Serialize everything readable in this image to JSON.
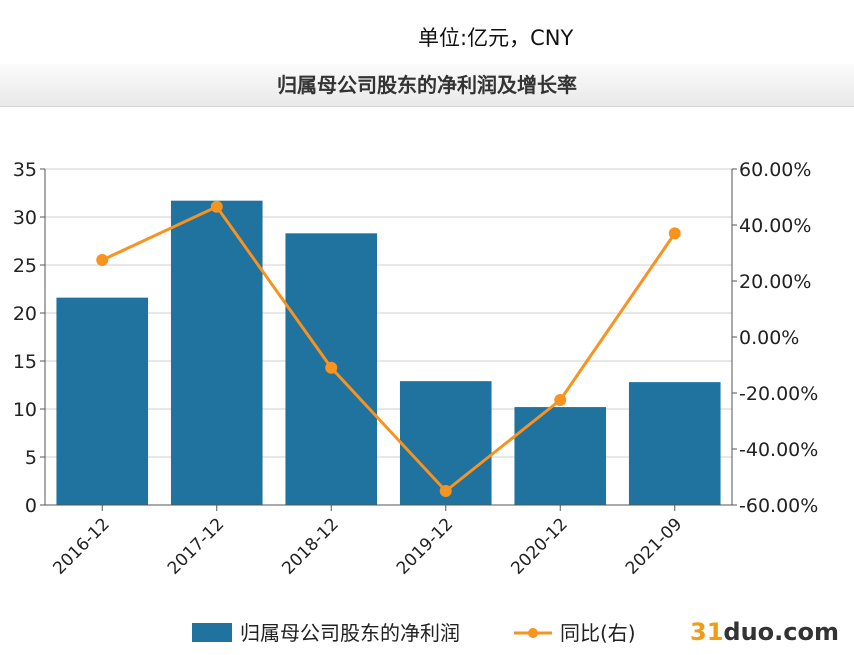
{
  "header": {
    "unit_label": "单位:亿元，CNY",
    "title": "归属母公司股东的净利润及增长率"
  },
  "watermark": {
    "part1": "31",
    "part2": "duo",
    "part3": ".com"
  },
  "colors": {
    "bar": "#20729f",
    "line": "#f7931e",
    "grid": "#d0d0d0",
    "axis": "#555555"
  },
  "chart_data": {
    "type": "bar",
    "categories": [
      "2016-12",
      "2017-12",
      "2018-12",
      "2019-12",
      "2020-12",
      "2021-09"
    ],
    "series": [
      {
        "name": "归属母公司股东的净利润",
        "type": "bar",
        "axis": "left",
        "values": [
          21.6,
          31.7,
          28.3,
          12.9,
          10.2,
          12.8
        ]
      },
      {
        "name": "同比(右)",
        "type": "line",
        "axis": "right",
        "values": [
          27.5,
          46.5,
          -11.0,
          -55.0,
          -22.5,
          37.0
        ]
      }
    ],
    "y_left": {
      "min": 0,
      "max": 35,
      "ticks": [
        "0",
        "5",
        "10",
        "15",
        "20",
        "25",
        "30",
        "35"
      ]
    },
    "y_right": {
      "min": -60,
      "max": 60,
      "ticks": [
        "-60.00%",
        "-40.00%",
        "-20.00%",
        "0.00%",
        "20.00%",
        "40.00%",
        "60.00%"
      ]
    },
    "grid": true,
    "legend_position": "bottom"
  }
}
